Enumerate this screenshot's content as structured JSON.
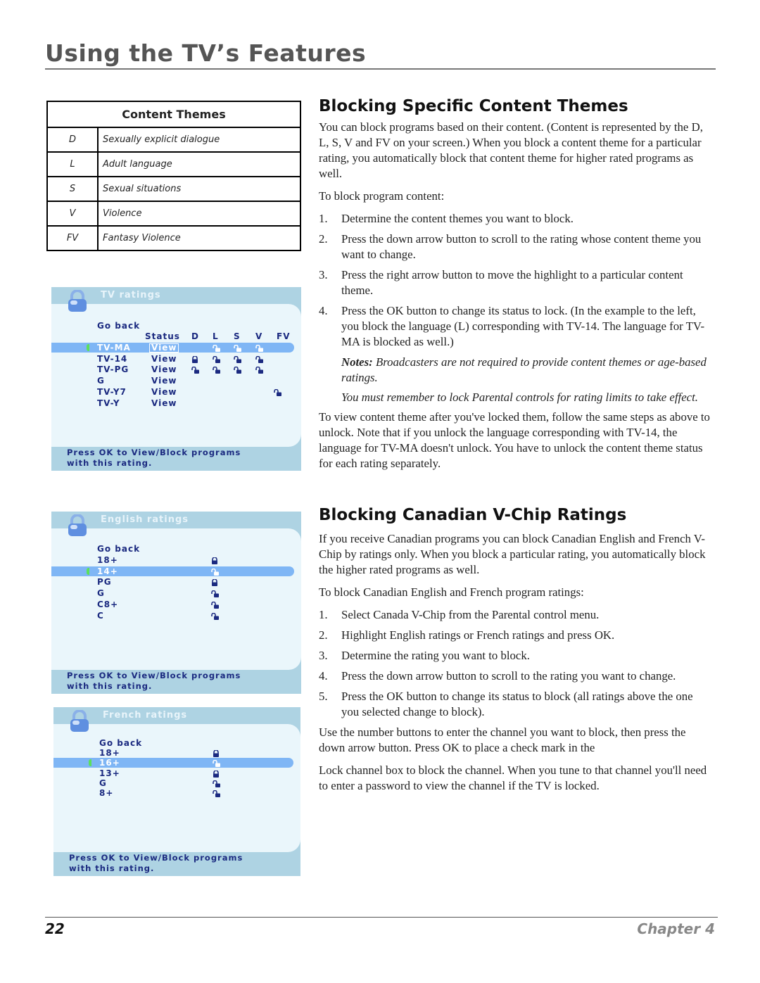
{
  "header": {
    "title": "Using the TV’s Features"
  },
  "content_themes": {
    "heading": "Content Themes",
    "rows": [
      [
        "D",
        "Sexually explicit dialogue"
      ],
      [
        "L",
        "Adult language"
      ],
      [
        "S",
        "Sexual situations"
      ],
      [
        "V",
        "Violence"
      ],
      [
        "FV",
        "Fantasy Violence"
      ]
    ]
  },
  "tv_screen": {
    "title": "TV ratings",
    "go_back": "Go back",
    "columns": [
      "Status",
      "D",
      "L",
      "S",
      "V",
      "FV"
    ],
    "rows": [
      {
        "rating": "TV-MA",
        "status": "View",
        "highlight": true,
        "locks": [
          null,
          "unlocked",
          "unlocked",
          "unlocked",
          null
        ]
      },
      {
        "rating": "TV-14",
        "status": "View",
        "locks": [
          "locked",
          "unlocked",
          "unlocked",
          "unlocked",
          null
        ]
      },
      {
        "rating": "TV-PG",
        "status": "View",
        "locks": [
          "unlocked",
          "unlocked",
          "unlocked",
          "unlocked",
          null
        ]
      },
      {
        "rating": "G",
        "status": "View",
        "locks": [
          null,
          null,
          null,
          null,
          null
        ]
      },
      {
        "rating": "TV-Y7",
        "status": "View",
        "locks": [
          null,
          null,
          null,
          null,
          "unlocked"
        ]
      },
      {
        "rating": "TV-Y",
        "status": "View",
        "locks": [
          null,
          null,
          null,
          null,
          null
        ]
      }
    ],
    "footer": [
      "Press OK to View/Block programs",
      "with this rating."
    ]
  },
  "english_screen": {
    "title": "English ratings",
    "go_back": "Go back",
    "rows": [
      {
        "rating": "18+",
        "lock": "locked"
      },
      {
        "rating": "14+",
        "lock": "unlocked",
        "highlight": true
      },
      {
        "rating": "PG",
        "lock": "locked"
      },
      {
        "rating": "G",
        "lock": "unlocked"
      },
      {
        "rating": "C8+",
        "lock": "unlocked"
      },
      {
        "rating": "C",
        "lock": "unlocked"
      }
    ],
    "footer": [
      "Press OK to View/Block programs",
      "with this rating."
    ]
  },
  "french_screen": {
    "title": "French ratings",
    "go_back": "Go back",
    "rows": [
      {
        "rating": "18+",
        "lock": "locked"
      },
      {
        "rating": "16+",
        "lock": "unlocked",
        "highlight": true
      },
      {
        "rating": "13+",
        "lock": "locked"
      },
      {
        "rating": "G",
        "lock": "unlocked"
      },
      {
        "rating": "8+",
        "lock": "unlocked"
      }
    ],
    "footer": [
      "Press OK to View/Block programs",
      "with this rating."
    ]
  },
  "section1": {
    "heading": "Blocking Specific Content Themes",
    "intro": "You can block programs based on their content. (Content is represented by the D, L, S, V and FV on your screen.) When you block a content theme for a particular rating, you automatically block that content theme for higher rated programs as well.",
    "lead": "To block program content:",
    "steps": [
      "Determine the content themes you want to block.",
      "Press the down arrow button to scroll to the rating whose content theme you want to change.",
      "Press the right arrow button to move the highlight to a particular content theme.",
      "Press the OK button to change its status to lock. (In the example to the left, you block the language (L) corresponding with TV-14. The language for TV-MA is blocked as well.)"
    ],
    "notes_label": "Notes:",
    "note1": "Broadcasters are not required to provide content themes or age-based ratings.",
    "note2": "You must remember to lock Parental controls for rating limits to take effect.",
    "outro": "To view content theme after you've locked them, follow the same steps as above to unlock. Note that if you unlock the language corresponding with TV-14, the language for TV-MA doesn't unlock. You have to unlock the content theme status for each rating separately."
  },
  "section2": {
    "heading": "Blocking Canadian V-Chip Ratings",
    "intro": "If you receive Canadian programs you can block Canadian English and French V-Chip by ratings only. When you block a particular rating, you automatically block the higher rated programs as well.",
    "lead": "To block Canadian English and French program ratings:",
    "steps": [
      "Select Canada V-Chip from the Parental control menu.",
      "Highlight English ratings or French ratings and press OK.",
      "Determine the rating you want to block.",
      "Press the down arrow button to scroll to the rating you want to change.",
      "Press the OK button to change its status to block (all ratings above the one you selected change to block)."
    ],
    "para1": "Use the number buttons to enter the channel you want to block, then press the down arrow button. Press OK to place a check mark in the",
    "para2": "Lock channel box to block the channel. When you tune to that channel you'll need to enter a password to view the channel if the TV is locked."
  },
  "footer": {
    "page_number": "22",
    "chapter": "Chapter 4"
  }
}
